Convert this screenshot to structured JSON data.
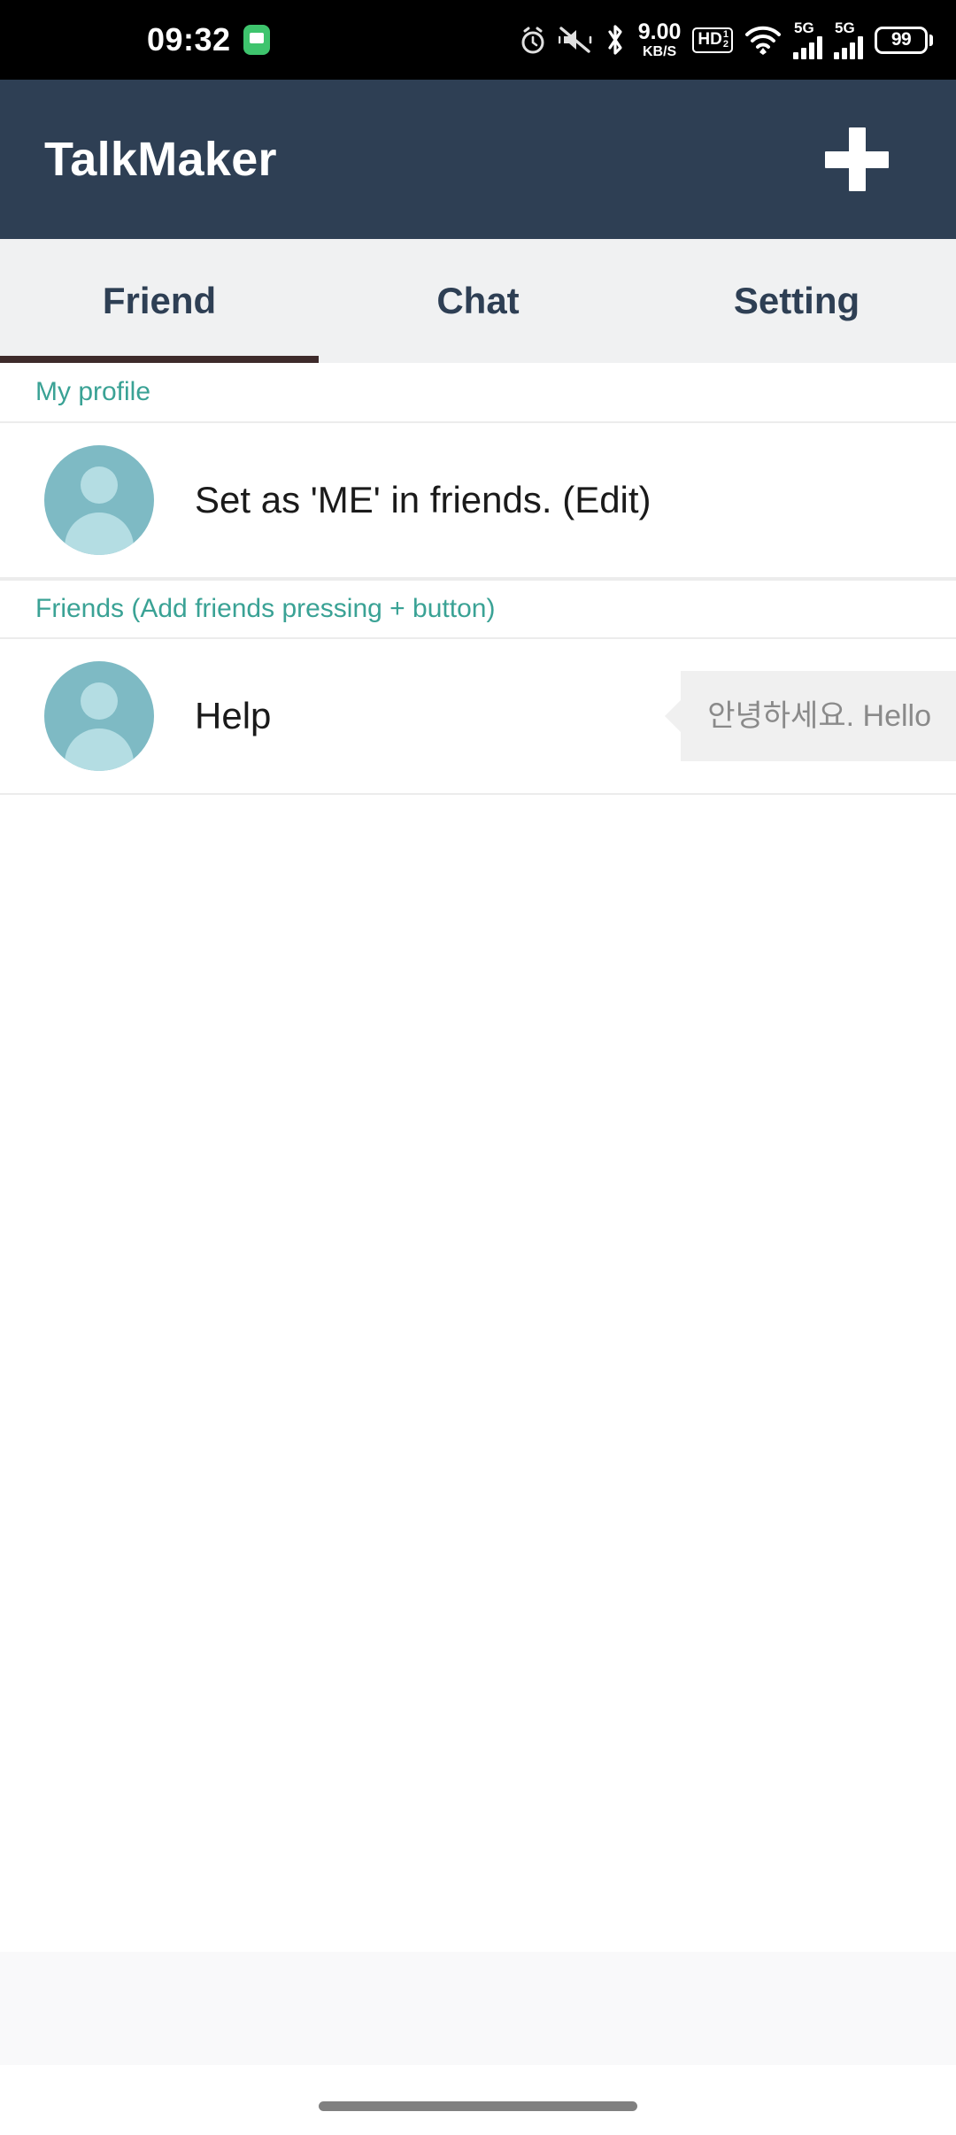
{
  "status_bar": {
    "time": "09:32",
    "notification_icon": "message-icon",
    "icons": [
      "alarm-icon",
      "mute-icon",
      "bluetooth-icon",
      "network-speed",
      "hd-voice-icon",
      "wifi-icon",
      "signal-5g-sim1",
      "signal-5g-sim2",
      "battery-icon"
    ],
    "network_speed_value": "9.00",
    "network_speed_unit": "KB/S",
    "hd_label": "HD",
    "hd_sup": "1",
    "hd_sub": "2",
    "sim1_label": "5G",
    "sim2_label": "5G",
    "battery_level": "99",
    "background": "#000000"
  },
  "app_bar": {
    "title": "TalkMaker",
    "add_button_label": "+",
    "background": "#2e3f54",
    "text_color": "#ffffff"
  },
  "tabs": {
    "active_index": 0,
    "indicator_color": "#3e2b2b",
    "background": "#f0f1f2",
    "items": [
      {
        "label": "Friend"
      },
      {
        "label": "Chat"
      },
      {
        "label": "Setting"
      }
    ]
  },
  "friend_list": {
    "accent_color": "#3aa295",
    "avatar_color": "#7ebac4",
    "sections": [
      {
        "header": "My profile",
        "rows": [
          {
            "name": "Set as 'ME' in friends. (Edit)",
            "bubble": null
          }
        ]
      },
      {
        "header": "Friends (Add friends pressing + button)",
        "rows": [
          {
            "name": "Help",
            "bubble": "안녕하세요. Hello"
          }
        ]
      }
    ]
  },
  "bottom": {
    "band_color": "#f9f9fa",
    "nav_pill_color": "#808080"
  }
}
